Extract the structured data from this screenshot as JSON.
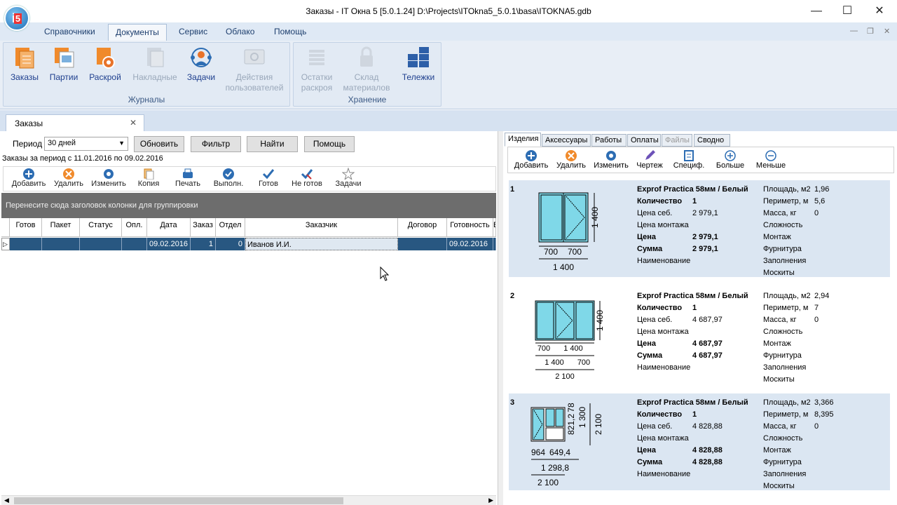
{
  "window": {
    "title": "Заказы - IT Окна 5 [5.0.1.24] D:\\Projects\\ITOkna5_5.0.1\\basa\\ITOKNA5.gdb",
    "logo_text": "i5",
    "min": "—",
    "max": "☐",
    "close": "✕"
  },
  "menu": {
    "items": [
      "Справочники",
      "Документы",
      "Сервис",
      "Облако",
      "Помощь"
    ],
    "active": "Документы"
  },
  "ribbon": {
    "groups": [
      {
        "label": "Журналы",
        "buttons": [
          "Заказы",
          "Партии",
          "Раскрой",
          "Накладные",
          "Задачи",
          "Действия пользователей"
        ]
      },
      {
        "label": "Хранение",
        "buttons": [
          "Остатки раскроя",
          "Склад материалов",
          "Тележки"
        ]
      }
    ],
    "b_orders": "Заказы",
    "b_parties": "Партии",
    "b_cut": "Раскрой",
    "b_invoices": "Накладные",
    "b_tasks": "Задачи",
    "b_actions_1": "Действия",
    "b_actions_2": "пользователей",
    "b_rem_1": "Остатки",
    "b_rem_2": "раскроя",
    "b_stock_1": "Склад",
    "b_stock_2": "материалов",
    "b_carts": "Тележки",
    "g_journals": "Журналы",
    "g_storage": "Хранение"
  },
  "doc_tab": {
    "label": "Заказы",
    "close": "✕"
  },
  "filter": {
    "period_label": "Период",
    "period_value": "30 дней",
    "refresh": "Обновить",
    "filter": "Фильтр",
    "find": "Найти",
    "help": "Помощь",
    "period_info": "Заказы за период с 11.01.2016 по 09.02.2016"
  },
  "toolbar": {
    "add": "Добавить",
    "delete": "Удалить",
    "edit": "Изменить",
    "copy": "Копия",
    "print": "Печать",
    "done": "Выполн.",
    "ready": "Готов",
    "not_ready": "Не готов",
    "tasks": "Задачи"
  },
  "grid": {
    "group_hint": "Перенесите сюда заголовок колонки для группировки",
    "columns": [
      "Готов",
      "Пакет",
      "Статус",
      "Опл.",
      "Дата",
      "Заказ",
      "Отдел",
      "Заказчик",
      "Договор",
      "Готовность",
      "В"
    ],
    "row": {
      "ready": "",
      "packet": "",
      "status": "",
      "paid": "",
      "date": "09.02.2016",
      "order": "1",
      "dept": "0",
      "customer": "Иванов И.И.",
      "contract": "",
      "readiness": "09.02.2016"
    }
  },
  "right_tabs": [
    "Изделия",
    "Аксессуары",
    "Работы",
    "Оплаты",
    "Файлы",
    "Сводно"
  ],
  "right_toolbar": {
    "add": "Добавить",
    "delete": "Удалить",
    "edit": "Изменить",
    "drawing": "Чертеж",
    "spec": "Специф.",
    "more": "Больше",
    "less": "Меньше"
  },
  "item_labels": {
    "qty": "Количество",
    "cost": "Цена себ.",
    "mount_price": "Цена монтажа",
    "price": "Цена",
    "sum": "Сумма",
    "naming": "Наименование",
    "area": "Площадь, м2",
    "perimeter": "Периметр, м",
    "mass": "Масса, кг",
    "complexity": "Сложность",
    "mount": "Монтаж",
    "hardware": "Фурнитура",
    "fill": "Заполнения",
    "mosquito": "Москиты"
  },
  "items": [
    {
      "num": "1",
      "name": "Exprof Practica 58мм / Белый",
      "qty": "1",
      "cost": "2 979,1",
      "price": "2 979,1",
      "sum": "2 979,1",
      "area": "1,96",
      "perimeter": "5,6",
      "mass": "0",
      "dims": {
        "h": "1 400",
        "w1": "700",
        "w2": "700",
        "w": "1 400"
      }
    },
    {
      "num": "2",
      "name": "Exprof Practica 58мм / Белый",
      "qty": "1",
      "cost": "4 687,97",
      "price": "4 687,97",
      "sum": "4 687,97",
      "area": "2,94",
      "perimeter": "7",
      "mass": "0",
      "dims": {
        "h": "1 400",
        "a": "700",
        "b": "1 400",
        "c": "1 400",
        "d": "700",
        "w": "2 100"
      }
    },
    {
      "num": "3",
      "name": "Exprof Practica 58мм / Белый",
      "qty": "1",
      "cost": "4 828,88",
      "price": "4 828,88",
      "sum": "4 828,88",
      "area": "3,366",
      "perimeter": "8,395",
      "mass": "0",
      "dims": {
        "v1": "821,2",
        "v2": "78",
        "v3": "1 300",
        "h": "2 100",
        "a": "964",
        "b": "649,4",
        "c": "1 298,8",
        "w": "2 100"
      }
    }
  ],
  "colors": {
    "accent": "#285781",
    "glass": "#7fd8e8",
    "ribbon_bg": "#e8eef6"
  }
}
